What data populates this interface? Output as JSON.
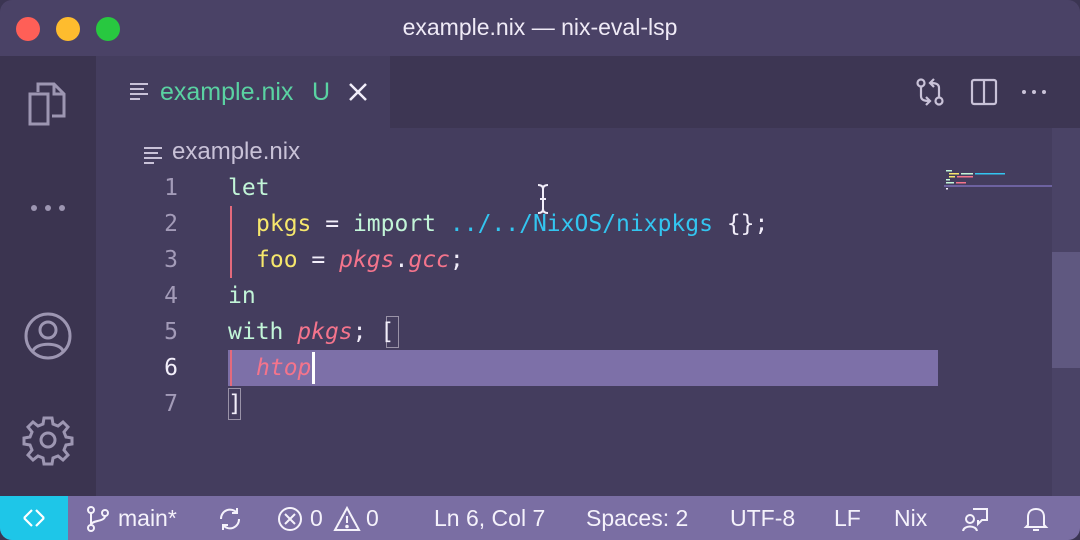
{
  "window": {
    "title": "example.nix — nix-eval-lsp"
  },
  "activity_bar": {
    "items": [
      {
        "name": "explorer",
        "icon": "files-icon"
      },
      {
        "name": "more",
        "icon": "ellipsis-icon"
      },
      {
        "name": "accounts",
        "icon": "account-icon"
      },
      {
        "name": "manage",
        "icon": "gear-icon"
      }
    ]
  },
  "tabs": [
    {
      "label": "example.nix",
      "status": "U",
      "active": true,
      "color": "#5ad2a2"
    }
  ],
  "editor_actions": [
    "source-control-compare-icon",
    "split-editor-icon",
    "more-actions-icon"
  ],
  "breadcrumb": {
    "file": "example.nix"
  },
  "code": {
    "active_line": 6,
    "lines": [
      {
        "num": "1"
      },
      {
        "num": "2"
      },
      {
        "num": "3"
      },
      {
        "num": "4"
      },
      {
        "num": "5"
      },
      {
        "num": "6"
      },
      {
        "num": "7"
      }
    ],
    "tokens": {
      "l1_let": "let",
      "l2_pkgs": "pkgs",
      "l2_eq": " = ",
      "l2_import": "import",
      "l2_path": " ../../NixOS/nixpkgs",
      "l2_rest": " {};",
      "l3_foo": "foo",
      "l3_eq": " = ",
      "l3_pkgs": "pkgs",
      "l3_dot": ".",
      "l3_gcc": "gcc",
      "l3_semi": ";",
      "l4_in": "in",
      "l5_with": "with",
      "l5_space": " ",
      "l5_pkgs": "pkgs",
      "l5_semi": "; ",
      "l5_bracket": "[",
      "l6_htop": "htop",
      "l7_bracket": "]"
    }
  },
  "status_bar": {
    "branch": "main*",
    "errors": "0",
    "warnings": "0",
    "position": "Ln 6, Col 7",
    "spaces": "Spaces: 2",
    "encoding": "UTF-8",
    "eol": "LF",
    "language": "Nix",
    "colors": {
      "background": "#7a6ea3",
      "remote": "#1ec6e8"
    }
  }
}
